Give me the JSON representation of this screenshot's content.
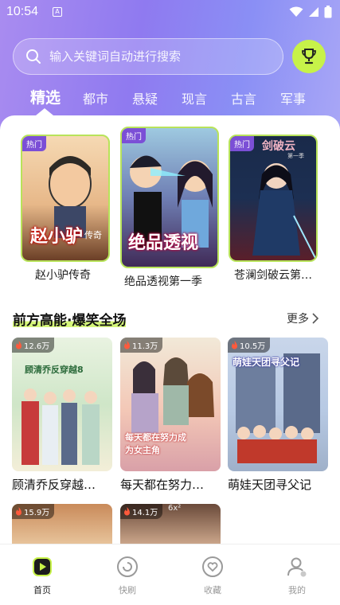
{
  "status_bar": {
    "time": "10:54",
    "app_icon_letter": "A"
  },
  "search": {
    "placeholder": "输入关键词自动进行搜索"
  },
  "tabs": [
    {
      "label": "精选",
      "active": true
    },
    {
      "label": "都市"
    },
    {
      "label": "悬疑"
    },
    {
      "label": "现言"
    },
    {
      "label": "古言"
    },
    {
      "label": "军事"
    }
  ],
  "featured": [
    {
      "badge": "热门",
      "title": "赵小驴传奇",
      "cover_text": "赵小驴",
      "cover_sub": "传奇"
    },
    {
      "badge": "热门",
      "title": "绝品透视第一季",
      "cover_text": "绝品透视"
    },
    {
      "badge": "热门",
      "title": "苍澜剑破云第…",
      "cover_text": "剑破云",
      "cover_sub": "第一季"
    }
  ],
  "section": {
    "title": "前方高能·爆笑全场",
    "more": "更多"
  },
  "grid": [
    {
      "heat": "12.6万",
      "title": "顾清乔反穿越…",
      "cover_text": "顾清乔反穿越8"
    },
    {
      "heat": "11.3万",
      "title": "每天都在努力…",
      "cover_text": "每天都在努力成为女主角"
    },
    {
      "heat": "10.5万",
      "title": "萌娃天团寻父记",
      "cover_text": "萌娃天团寻父记"
    },
    {
      "heat": "15.9万"
    },
    {
      "heat": "14.1万",
      "cover_text": "6x²"
    }
  ],
  "bottom_nav": [
    {
      "label": "首页",
      "active": true
    },
    {
      "label": "快刷"
    },
    {
      "label": "收藏"
    },
    {
      "label": "我的"
    }
  ],
  "colors": {
    "accent": "#c7f249",
    "badge": "#7b4fd6",
    "header_start": "#a98cf0",
    "header_end": "#8a8ff5"
  }
}
